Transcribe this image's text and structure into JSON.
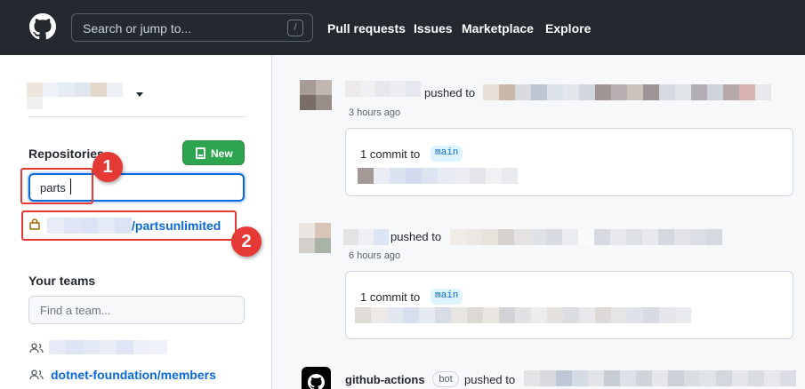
{
  "header": {
    "search_placeholder": "Search or jump to...",
    "search_shortcut": "/",
    "nav": [
      "Pull requests",
      "Issues",
      "Marketplace",
      "Explore"
    ]
  },
  "sidebar": {
    "repositories_label": "Repositories",
    "new_button": "New",
    "repo_filter_value": "parts",
    "repo_result": "/partsunlimited",
    "teams_label": "Your teams",
    "team_filter_placeholder": "Find a team...",
    "team_link": "dotnet-foundation/members"
  },
  "annotations": [
    "1",
    "2"
  ],
  "feed": [
    {
      "action": "pushed to",
      "time": "3 hours ago",
      "commit_summary": "1 commit to",
      "branch": "main"
    },
    {
      "action": "pushed to",
      "time": "6 hours ago",
      "commit_summary": "1 commit to",
      "branch": "main"
    },
    {
      "actor": "github-actions",
      "badge": "bot",
      "action": "pushed to"
    }
  ],
  "colors": {
    "header_bg": "#24292f",
    "new_button_bg": "#2da44e",
    "link": "#0969da",
    "annotation": "#e53935"
  }
}
